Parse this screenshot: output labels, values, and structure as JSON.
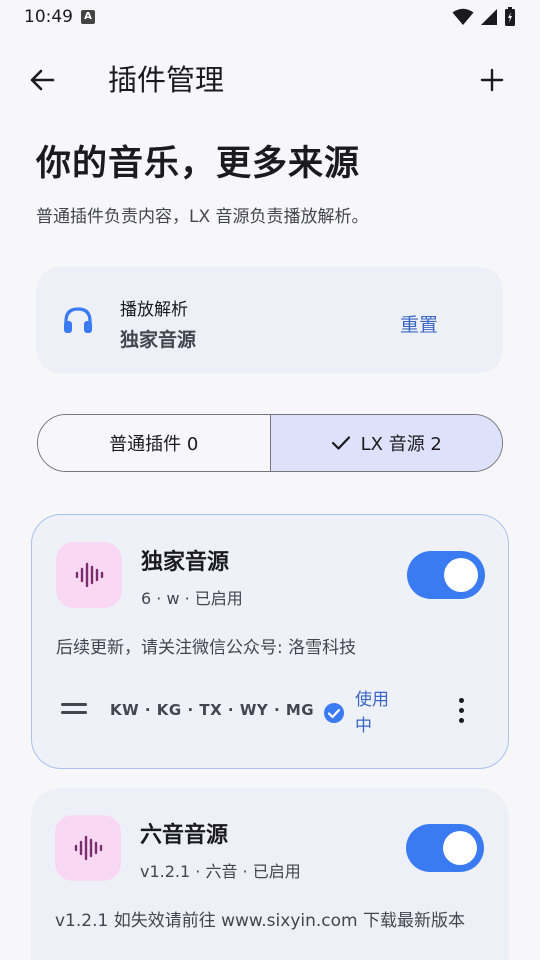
{
  "status_bar": {
    "time": "10:49",
    "badge": "A"
  },
  "top_bar": {
    "title": "插件管理"
  },
  "hero": {
    "title": "你的音乐，更多来源",
    "subtitle": "普通插件负责内容，LX 音源负责播放解析。"
  },
  "playback": {
    "label": "播放解析",
    "value": "独家音源",
    "reset": "重置"
  },
  "tabs": [
    {
      "label": "普通插件 0",
      "selected": false
    },
    {
      "label": "LX 音源 2",
      "selected": true
    }
  ],
  "plugins": [
    {
      "name": "独家音源",
      "meta": "6 · w · 已启用",
      "enabled": true,
      "description": "后续更新，请关注微信公众号: 洛雪科技",
      "sources": "KW · KG · TX · WY · MG",
      "in_use_label": "使用中"
    },
    {
      "name": "六音音源",
      "meta": "v1.2.1 · 六音 · 已启用",
      "enabled": true,
      "description": "v1.2.1 如失效请前往 www.sixyin.com 下载最新版本"
    }
  ],
  "colors": {
    "accent": "#3a7bf2",
    "link": "#3a66c4",
    "icon_bg": "#f9d8f3",
    "icon_fg": "#7a2e6e"
  }
}
